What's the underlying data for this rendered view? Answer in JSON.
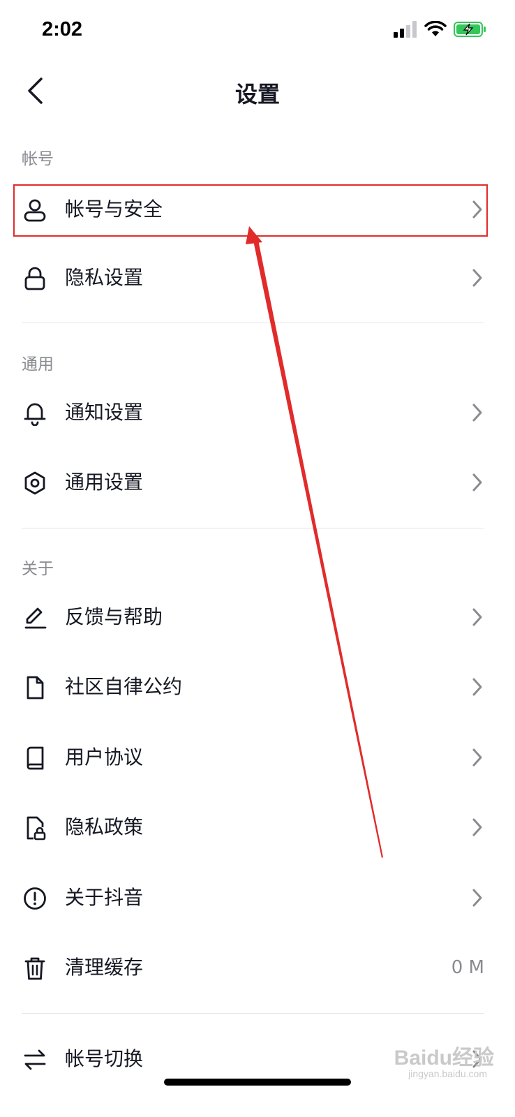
{
  "status": {
    "time": "2:02"
  },
  "nav": {
    "title": "设置"
  },
  "sections": {
    "account": "帐号",
    "general": "通用",
    "about": "关于"
  },
  "items": {
    "account_security": "帐号与安全",
    "privacy_settings": "隐私设置",
    "notification_settings": "通知设置",
    "general_settings": "通用设置",
    "feedback_help": "反馈与帮助",
    "community_rules": "社区自律公约",
    "user_agreement": "用户协议",
    "privacy_policy": "隐私政策",
    "about_douyin": "关于抖音",
    "clear_cache": "清理缓存",
    "clear_cache_value": "0 M",
    "switch_account": "帐号切换"
  },
  "watermark": {
    "brand": "Baidu经验",
    "url": "jingyan.baidu.com"
  },
  "colors": {
    "text": "#161823",
    "secondary": "#8a8b91",
    "annotation": "#e12b2b",
    "battery": "#34c759"
  }
}
